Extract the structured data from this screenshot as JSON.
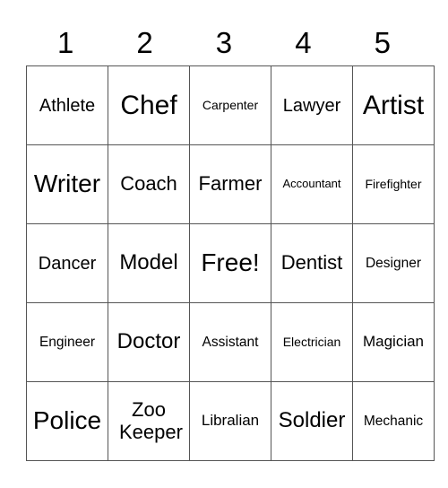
{
  "header": [
    "1",
    "2",
    "3",
    "4",
    "5"
  ],
  "rows": [
    [
      "Athlete",
      "Chef",
      "Carpenter",
      "Lawyer",
      "Artist"
    ],
    [
      "Writer",
      "Coach",
      "Farmer",
      "Accountant",
      "Firefighter"
    ],
    [
      "Dancer",
      "Model",
      "Free!",
      "Dentist",
      "Designer"
    ],
    [
      "Engineer",
      "Doctor",
      "Assistant",
      "Electrician",
      "Magician"
    ],
    [
      "Police",
      "Zoo Keeper",
      "Libralian",
      "Soldier",
      "Mechanic"
    ]
  ]
}
